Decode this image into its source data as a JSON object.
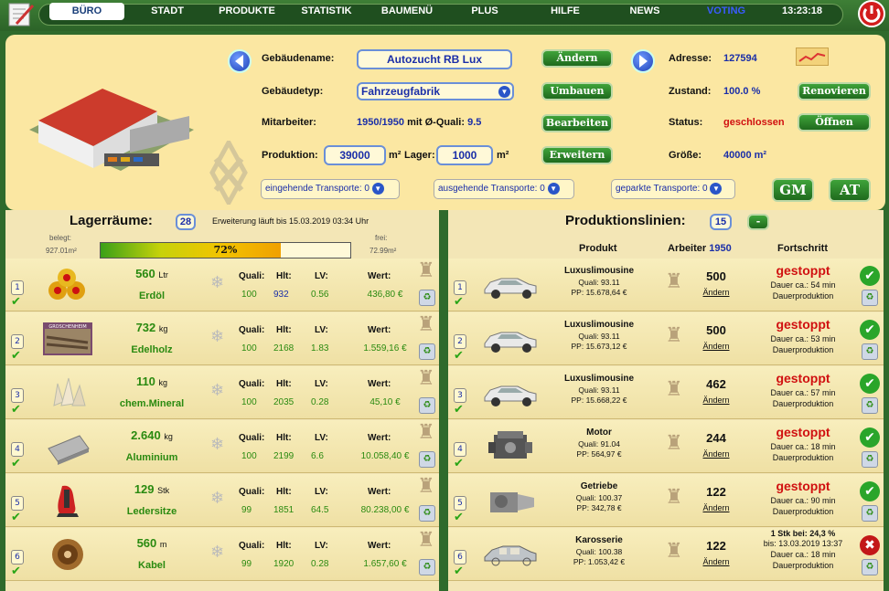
{
  "nav": {
    "items": [
      "BÜRO",
      "STADT",
      "PRODUKTE",
      "STATISTIK",
      "BAUMENÜ",
      "PLUS",
      "HILFE",
      "NEWS",
      "VOTING"
    ],
    "clock": "13:23:18"
  },
  "building": {
    "name_label": "Gebäudename:",
    "name_value": "Autozucht RB Lux",
    "type_label": "Gebäudetyp:",
    "type_value": "Fahrzeugfabrik",
    "staff_label": "Mitarbeiter:",
    "staff_value": "1950/1950",
    "staff_mid": "mit Ø-Quali:",
    "staff_quali": "9.5",
    "production_label": "Produktion:",
    "production_value": "39000",
    "production_unit": "m²",
    "storage_label": "Lager:",
    "storage_value": "1000",
    "storage_unit": "m²",
    "btn_change": "Ändern",
    "btn_rebuild": "Umbauen",
    "btn_edit": "Bearbeiten",
    "btn_expand": "Erweitern",
    "address_label": "Adresse:",
    "address_value": "127594",
    "state_label": "Zustand:",
    "state_value": "100.0 %",
    "status_label": "Status:",
    "status_value": "geschlossen",
    "size_label": "Größe:",
    "size_value": "40000 m²",
    "btn_renovate": "Renovieren",
    "btn_open": "Öffnen",
    "btn_gm": "GM",
    "btn_at": "AT",
    "transport_in": "eingehende Transporte: 0",
    "transport_out": "ausgehende Transporte: 0",
    "transport_parked": "geparkte Transporte: 0"
  },
  "storage": {
    "title": "Lagerräume:",
    "count": "28",
    "expansion_note": "Erweiterung läuft bis 15.03.2019 03:34 Uhr",
    "used_label": "belegt:",
    "used_value": "927.01m²",
    "free_label": "frei:",
    "free_value": "72.99m²",
    "fill_percent_label": "72%",
    "fill_fraction": 0.72,
    "col_quali": "Quali:",
    "col_hlt": "Hlt:",
    "col_lv": "LV:",
    "col_value": "Wert:",
    "items": [
      {
        "idx": "1",
        "amount": "560",
        "unit": "Ltr",
        "name": "Erdöl",
        "quali": "100",
        "hlt": "932",
        "lv": "0.56",
        "value": "436,80 €",
        "icon": "oil-barrels-icon"
      },
      {
        "idx": "2",
        "amount": "732",
        "unit": "kg",
        "name": "Edelholz",
        "quali": "100",
        "hlt": "2168",
        "lv": "1.83",
        "value": "1.559,16 €",
        "icon": "wood-icon",
        "img_label": "GROSCHENHEIM"
      },
      {
        "idx": "3",
        "amount": "110",
        "unit": "kg",
        "name": "chem.Mineral",
        "quali": "100",
        "hlt": "2035",
        "lv": "0.28",
        "value": "45,10 €",
        "icon": "crystal-icon"
      },
      {
        "idx": "4",
        "amount": "2.640",
        "unit": "kg",
        "name": "Aluminium",
        "quali": "100",
        "hlt": "2199",
        "lv": "6.6",
        "value": "10.058,40 €",
        "icon": "aluminium-foil-icon"
      },
      {
        "idx": "5",
        "amount": "129",
        "unit": "Stk",
        "name": "Ledersitze",
        "quali": "99",
        "hlt": "1851",
        "lv": "64.5",
        "value": "80.238,00 €",
        "icon": "car-seat-icon"
      },
      {
        "idx": "6",
        "amount": "560",
        "unit": "m",
        "name": "Kabel",
        "quali": "99",
        "hlt": "1920",
        "lv": "0.28",
        "value": "1.657,60 €",
        "icon": "cable-reel-icon"
      }
    ]
  },
  "production": {
    "title": "Produktionslinien:",
    "count": "15",
    "minus": "-",
    "col_product": "Produkt",
    "col_workers": "Arbeiter",
    "col_workers_total": "1950",
    "col_progress": "Fortschritt",
    "change_label": "Ändern",
    "lines": [
      {
        "idx": "1",
        "product": "Luxuslimousine",
        "quali": "Quali: 93.11",
        "pp": "PP: 15.678,64 €",
        "workers": "500",
        "status": "gestoppt",
        "line1": "Dauer ca.: 54 min",
        "line2": "Dauerproduktion",
        "ok": true
      },
      {
        "idx": "2",
        "product": "Luxuslimousine",
        "quali": "Quali: 93.11",
        "pp": "PP: 15.673,12 €",
        "workers": "500",
        "status": "gestoppt",
        "line1": "Dauer ca.: 53 min",
        "line2": "Dauerproduktion",
        "ok": true
      },
      {
        "idx": "3",
        "product": "Luxuslimousine",
        "quali": "Quali: 93.11",
        "pp": "PP: 15.668,22 €",
        "workers": "462",
        "status": "gestoppt",
        "line1": "Dauer ca.: 57 min",
        "line2": "Dauerproduktion",
        "ok": true
      },
      {
        "idx": "4",
        "product": "Motor",
        "quali": "Quali: 91.04",
        "pp": "PP: 564,97 €",
        "workers": "244",
        "status": "gestoppt",
        "line1": "Dauer ca.: 18 min",
        "line2": "Dauerproduktion",
        "ok": true
      },
      {
        "idx": "5",
        "product": "Getriebe",
        "quali": "Quali: 100.37",
        "pp": "PP: 342,78 €",
        "workers": "122",
        "status": "gestoppt",
        "line1": "Dauer ca.: 90 min",
        "line2": "Dauerproduktion",
        "ok": true
      },
      {
        "idx": "6",
        "product": "Karosserie",
        "quali": "Quali: 100.38",
        "pp": "PP: 1.053,42 €",
        "workers": "122",
        "status": "1 Stk bei: 24,3 %",
        "line1": "bis: 13.03.2019 13:37",
        "line2": "Dauer ca.: 18 min",
        "line3": "Dauerproduktion",
        "ok": false
      }
    ]
  },
  "colors": {
    "accent": "#1a2ea8",
    "status_red": "#d01010",
    "button_green": "#2a8a24"
  }
}
